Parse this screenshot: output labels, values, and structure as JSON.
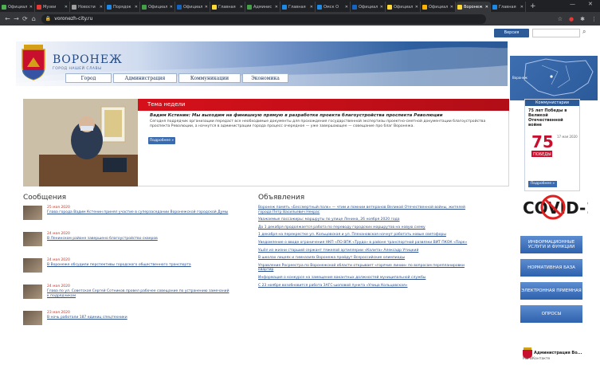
{
  "browser": {
    "tabs": [
      {
        "label": "Официал",
        "color": "#4caf50"
      },
      {
        "label": "Музеи",
        "color": "#e53935"
      },
      {
        "label": "Новости",
        "color": "#9e9e9e"
      },
      {
        "label": "Порядок",
        "color": "#1e88e5"
      },
      {
        "label": "Официал",
        "color": "#43a047"
      },
      {
        "label": "Официал",
        "color": "#1565c0"
      },
      {
        "label": "Главная",
        "color": "#fdd835"
      },
      {
        "label": "Админис",
        "color": "#43a047"
      },
      {
        "label": "Главная",
        "color": "#1e88e5"
      },
      {
        "label": "Омск О",
        "color": "#1e88e5"
      },
      {
        "label": "Официал",
        "color": "#1565c0"
      },
      {
        "label": "Официал",
        "color": "#fdd835"
      },
      {
        "label": "Официал",
        "color": "#ffb300"
      },
      {
        "label": "Воронеж",
        "color": "#fdd835",
        "active": true
      },
      {
        "label": "Главная",
        "color": "#1e88e5"
      }
    ],
    "new_tab": "+",
    "url": "voronezh-city.ru"
  },
  "top": {
    "version_label": "Версия"
  },
  "header": {
    "title": "ВОРОНЕЖ",
    "subtitle": "ГОРОД НАШЕЙ СЛАВЫ",
    "map_label": "Воронеж",
    "nav": [
      "Город",
      "Администрация",
      "Коммуникации",
      "Экономика"
    ]
  },
  "feature": {
    "bar_label": "Тема недели",
    "headline": "Вадим Кстенин: Мы выходим на финишную прямую в разработке проекта благоустройства проспекта Революции",
    "body": "Сегодня подрядчик организации передаст все необходимые документы для прохождения государственной экспертизы проектно-сметной документации благоустройства проспекта Революции, а начнутся в администрации города процесс очередное — уже завершающее — совещание про благ Воронежа.",
    "more": "Подробнее »"
  },
  "anniversary": {
    "header": "Коммунистарии",
    "title": "75 лет Победы в Великой Отечественной войне",
    "date": "17 мая 2020",
    "logo_text": "ПОБЕДЫ",
    "more": "Подробнее »"
  },
  "messages": {
    "title": "Сообщения",
    "items": [
      {
        "date": "25 мая 2020",
        "text": "Глава города Вадим Кстенин принял участие в суперзаседании Воронежской городской Думы"
      },
      {
        "date": "24 мая 2020",
        "text": "В Ленинском районе завершено благоустройство скверов"
      },
      {
        "date": "24 мая 2020",
        "text": "В Воронеже обсудили перспективы городского общественного транспорта"
      },
      {
        "date": "24 мая 2020",
        "text": "Глава по ул. Советская Сергей Сотников провел рабочее совещание по устранению замечаний к подрядчикам"
      },
      {
        "date": "23 мая 2020",
        "text": "В ночь работали 187 единиц спецтехники"
      }
    ]
  },
  "ads": {
    "title": "Объявления",
    "items": [
      "Воронеж память «Бессмертный полк» — чтим и помним ветеранов Великой Отечественной войны, жителей города Петр Васильевич Некрас",
      "Уважаемые пассажиры: маршруты по улице Ленина, 26 ноября 2020 года",
      "До 1 декабря продолжается работа по переводу городских маршрутов на новую схему",
      "1 декабря на перекрестке ул. Кольцовская и ул. Плехановская начнут работать новые светофоры",
      "Уведомление о вводе ограничения НКП «ПО ВПК «Трудо» в районе транспортной развязки ВИТ ПКОК «Парк»",
      "Ушёл из жизни старший сержант тяжелой артиллерии «Калита» Алексадр Утицкий",
      "В школах лицеях и гимназиях Воронежа пройдут Всероссийские олимпиады",
      "Управление Росреестра по Воронежской области открывает «горячие линии» по вопросам перепланировки квартир",
      "Информация о конкурсе на замещение вакантных должностей муниципальной службы",
      "С 23 ноября возобновится работа ЗАГС-шоповой пункта «Улица Кольцовская»"
    ]
  },
  "sidebar": {
    "covid_text": "COVID-19",
    "buttons": [
      "ИНФОРМАЦИОННЫЕ УСЛУГИ И ФУНКЦИИ",
      "НОРМАТИВНАЯ БАЗА",
      "ЭЛЕКТРОННАЯ ПРИЕМНАЯ",
      "ОПРОСЫ"
    ],
    "admin_name": "Администрация Во...",
    "admin_desc": "Мы ВКонтакте"
  }
}
